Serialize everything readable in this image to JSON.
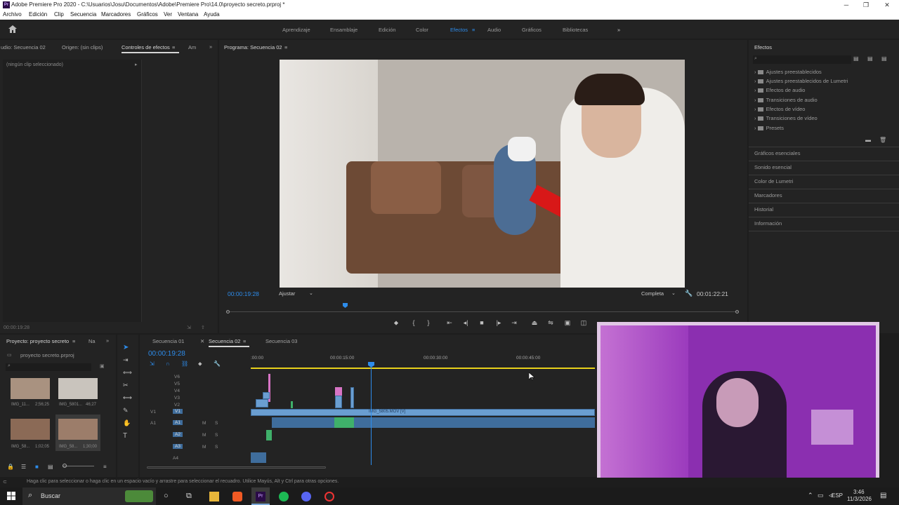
{
  "window": {
    "title": "Adobe Premiere Pro 2020 - C:\\Usuarios\\Josu\\Documentos\\Adobe\\Premiere Pro\\14.0\\proyecto secreto.prproj *",
    "app_icon": "Pr"
  },
  "menu": [
    "Archivo",
    "Edición",
    "Clip",
    "Secuencia",
    "Marcadores",
    "Gráficos",
    "Ver",
    "Ventana",
    "Ayuda"
  ],
  "workspaces": [
    "Aprendizaje",
    "Ensamblaje",
    "Edición",
    "Color",
    "Efectos",
    "Audio",
    "Gráficos",
    "Bibliotecas"
  ],
  "active_workspace": "Efectos",
  "source_panel": {
    "tabs": [
      "udio: Secuencia 02",
      "Origen: (sin clips)",
      "Controles de efectos",
      "Am"
    ],
    "empty_label": "(ningún clip seleccionado)",
    "timecode": "00:00:19:28"
  },
  "program": {
    "tab": "Programa: Secuencia 02",
    "timecode": "00:00:19:28",
    "fit": "Ajustar",
    "quality": "Completa",
    "duration": "00:01:22:21"
  },
  "effects": {
    "title": "Efectos",
    "tree": [
      "Ajustes preestablecidos",
      "Ajustes preestablecidos de Lumetri",
      "Efectos de audio",
      "Transiciones de audio",
      "Efectos de vídeo",
      "Transiciones de vídeo",
      "Presets"
    ],
    "side_panels": [
      "Gráficos esenciales",
      "Sonido esencial",
      "Color de Lumetri",
      "Marcadores",
      "Historial",
      "Información"
    ]
  },
  "project": {
    "tabs": [
      "Proyecto: proyecto secreto",
      "Na"
    ],
    "file": "proyecto secreto.prproj",
    "clips": [
      {
        "name": "IMG_11...",
        "duration": "2;56;25"
      },
      {
        "name": "IMG_5801...",
        "duration": "46;27"
      },
      {
        "name": "IMG_58...",
        "duration": "1;02;05"
      },
      {
        "name": "IMG_58...",
        "duration": "1;30;00"
      }
    ]
  },
  "timeline": {
    "tabs": [
      "Secuencia 01",
      "Secuencia 02",
      "Secuencia 03"
    ],
    "active_tab": "Secuencia 02",
    "timecode": "00:00:19:28",
    "ruler": [
      ":00:00",
      "00:00:15:00",
      "00:00:30:00",
      "00:00:45:00"
    ],
    "video_tracks": [
      "V6",
      "V5",
      "V4",
      "V3",
      "V2",
      "V1"
    ],
    "audio_tracks": [
      "A1",
      "A2",
      "A3",
      "A4"
    ],
    "main_clip": "IMG_5805.MOV [V]",
    "track_buttons": [
      "M",
      "S"
    ]
  },
  "status": {
    "message": "Haga clic para seleccionar o haga clic en un espacio vacío y arrastre para seleccionar el recuadro. Utilice Mayús, Alt y Ctrl para otras opciones."
  },
  "taskbar": {
    "search": "Buscar",
    "lang": "ESP",
    "time": "3:46",
    "date": "11/3/2026"
  },
  "colors": {
    "accent_blue": "#2d8ceb",
    "playhead_blue": "#2d8ceb",
    "work_area_yellow": "#e8d11b",
    "clip_video": "#6a9ed1",
    "clip_pink": "#d774c5",
    "clip_green": "#3fb06a"
  }
}
